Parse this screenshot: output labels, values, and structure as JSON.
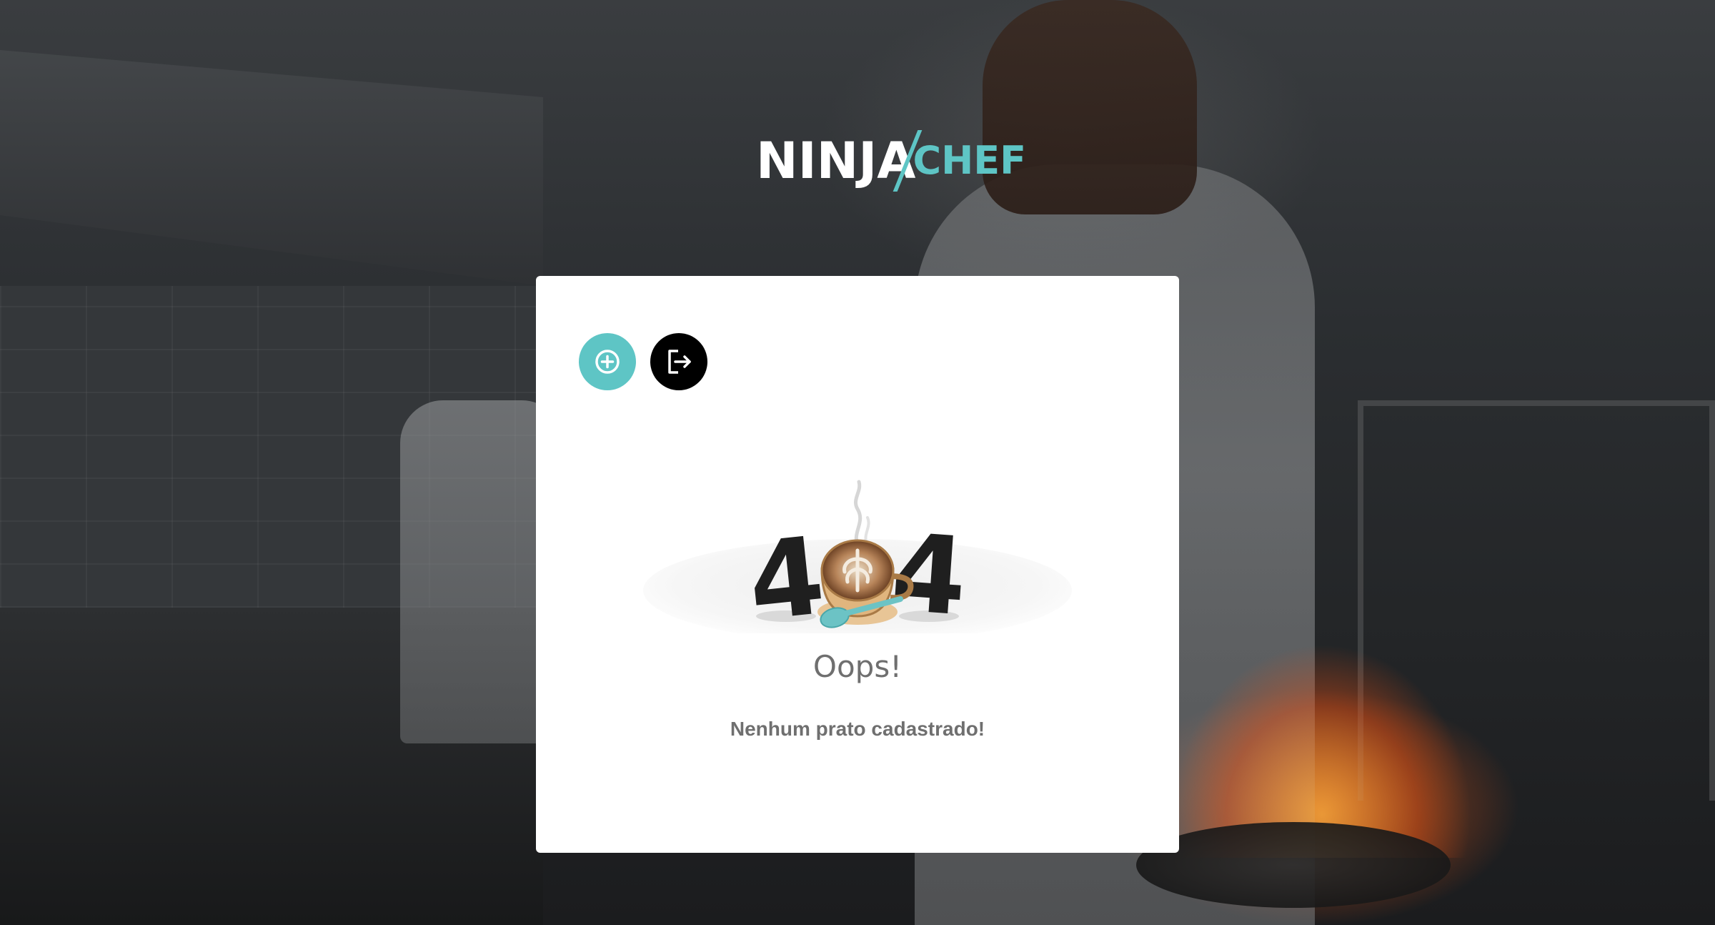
{
  "brand": {
    "name_part1": "NINJA",
    "name_part2": "CHEF",
    "accent_color": "#5ec5c5"
  },
  "toolbar": {
    "add_icon": "plus-circle-icon",
    "logout_icon": "logout-icon"
  },
  "empty_state": {
    "digit_left": "4",
    "digit_right": "4",
    "illustration_icon": "coffee-cup-icon",
    "title": "Oops!",
    "message": "Nenhum prato cadastrado!"
  }
}
